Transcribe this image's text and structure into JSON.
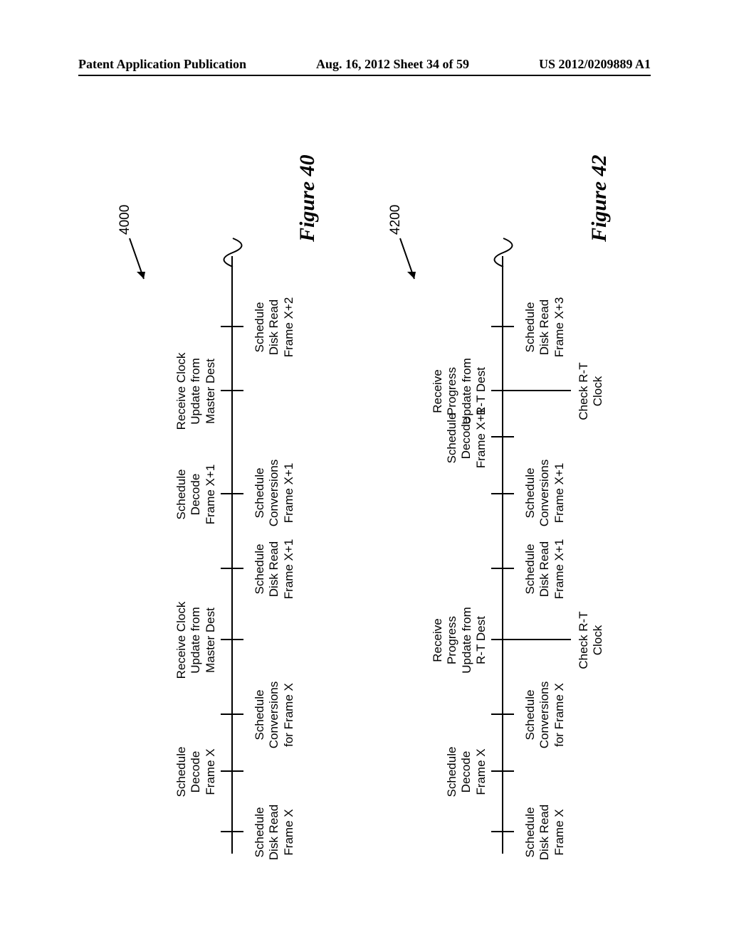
{
  "header": {
    "left": "Patent Application Publication",
    "center": "Aug. 16, 2012  Sheet 34 of 59",
    "right": "US 2012/0209889 A1"
  },
  "fig40": {
    "ref": "4000",
    "caption": "Figure 40",
    "above": {
      "a1": "Schedule\nDecode\nFrame X",
      "a2": "Receive Clock\nUpdate from\nMaster Dest",
      "a3": "Schedule\nDecode\nFrame X+1",
      "a4": "Receive Clock\nUpdate from\nMaster Dest"
    },
    "below": {
      "b1": "Schedule\nDisk Read\nFrame X",
      "b2": "Schedule\nConversions\nfor Frame X",
      "b3": "Schedule\nDisk Read\nFrame X+1",
      "b4": "Schedule\nConversions\nFrame X+1",
      "b5": "Schedule\nDisk Read\nFrame X+2"
    }
  },
  "fig42": {
    "ref": "4200",
    "caption": "Figure 42",
    "above": {
      "a1": "Schedule\nDecode\nFrame X",
      "a2": "Receive\nProgress\nUpdate from\nR-T Dest",
      "a3": "Schedule\nDecode\nFrame X+1",
      "a4": "Receive\nProgress\nUpdate from\nR-T Dest"
    },
    "below": {
      "b1": "Schedule\nDisk Read\nFrame X",
      "b2": "Schedule\nConversions\nfor Frame X",
      "b3": "Schedule\nDisk Read\nFrame X+1",
      "b4": "Schedule\nConversions\nFrame X+1",
      "b5": "Schedule\nDisk Read\nFrame X+3"
    },
    "bottom": {
      "c1": "Check R-T\nClock",
      "c2": "Check R-T\nClock"
    }
  }
}
